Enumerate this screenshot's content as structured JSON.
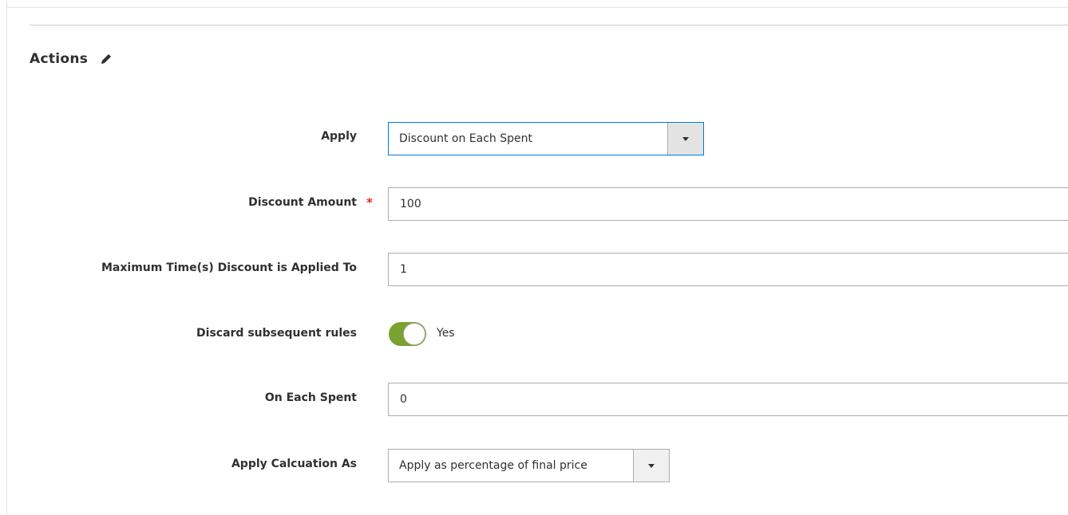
{
  "section": {
    "title": "Actions",
    "edit_icon": "pencil-icon"
  },
  "fields": {
    "apply": {
      "label": "Apply",
      "value": "Discount on Each Spent"
    },
    "discount_amount": {
      "label": "Discount Amount",
      "required_mark": "*",
      "value": "100"
    },
    "max_times": {
      "label": "Maximum Time(s) Discount is Applied To",
      "value": "1"
    },
    "discard_rules": {
      "label": "Discard subsequent rules",
      "state_label": "Yes",
      "checked": true,
      "on_color": "#79a22e"
    },
    "on_each_spent": {
      "label": "On Each Spent",
      "value": "0"
    },
    "calculation": {
      "label": "Apply Calcuation As",
      "value": "Apply as percentage of final price"
    }
  },
  "colors": {
    "focus_border": "#007bdb",
    "required": "#e22626",
    "toggle_on": "#79a22e"
  }
}
